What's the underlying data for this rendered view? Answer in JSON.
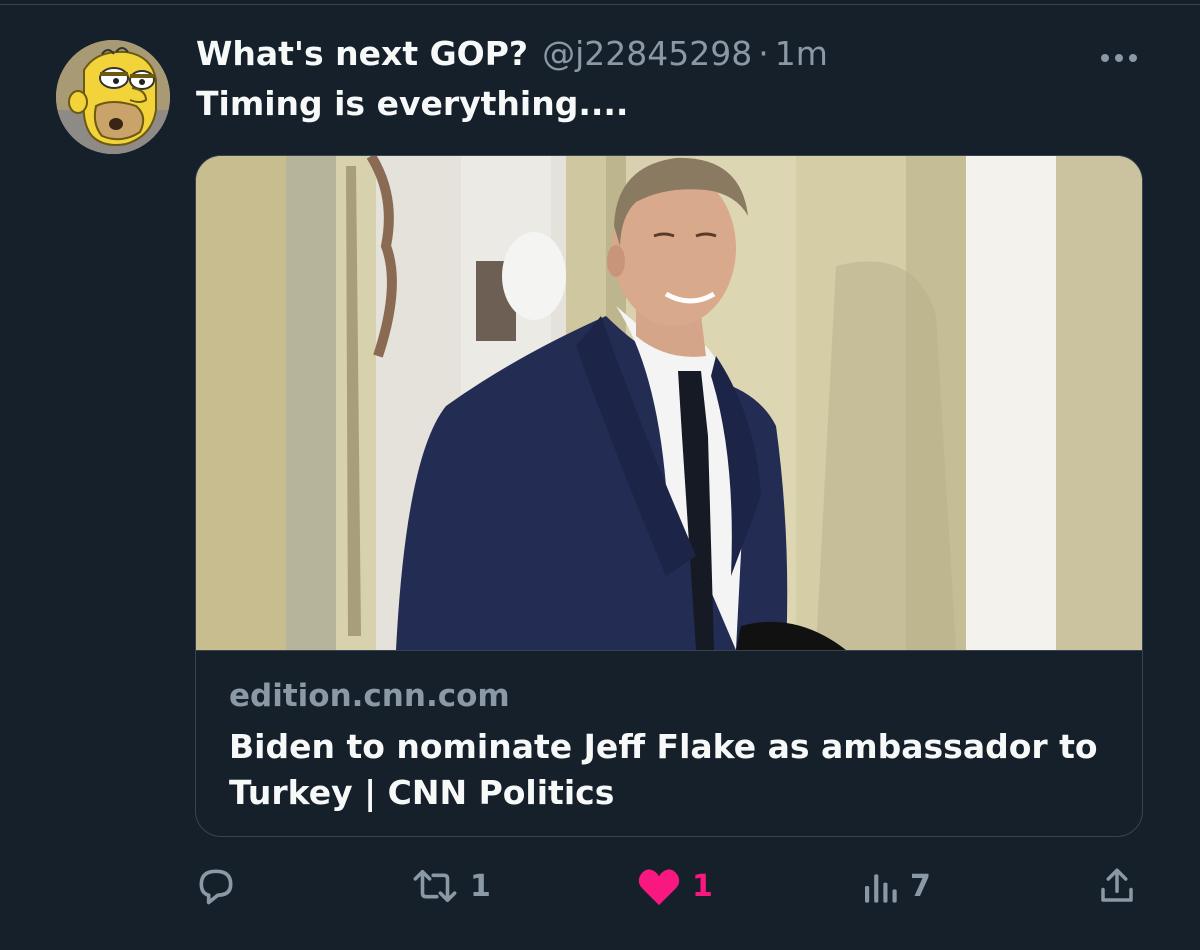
{
  "tweet": {
    "author_name": "What's next GOP?",
    "handle": "@j22845298",
    "separator": "·",
    "timestamp": "1m",
    "text": "Timing is everything....",
    "avatar_icon": "homer-simpson-avatar-icon",
    "more_icon": "more-dots-icon"
  },
  "card": {
    "domain": "edition.cnn.com",
    "title": "Biden to nominate Jeff Flake as ambassador to Turkey | CNN Politics"
  },
  "actions": {
    "reply": {
      "icon": "reply-icon",
      "count": ""
    },
    "retweet": {
      "icon": "retweet-icon",
      "count": "1"
    },
    "like": {
      "icon": "heart-filled-icon",
      "count": "1",
      "liked": true
    },
    "views": {
      "icon": "analytics-icon",
      "count": "7"
    },
    "share": {
      "icon": "share-icon",
      "count": ""
    }
  },
  "colors": {
    "background": "#15202b",
    "text_primary": "#f7f9f9",
    "text_secondary": "#8b98a5",
    "border": "#38444d",
    "like_pink": "#f91880"
  }
}
